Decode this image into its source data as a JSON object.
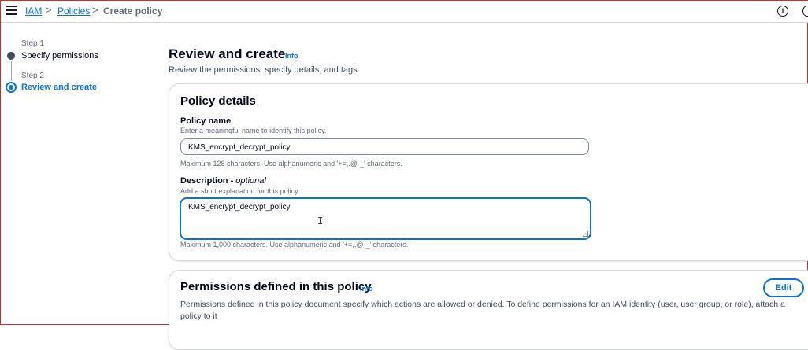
{
  "breadcrumb": {
    "items": [
      {
        "label": "IAM",
        "link": true
      },
      {
        "label": "Policies",
        "link": true
      },
      {
        "label": "Create policy",
        "link": false
      }
    ],
    "separator": ">"
  },
  "header": {
    "info_icon": "ⓘ"
  },
  "steps": [
    {
      "step": "Step 1",
      "title": "Specify permissions",
      "state": "done"
    },
    {
      "step": "Step 2",
      "title": "Review and create",
      "state": "active"
    }
  ],
  "page": {
    "title": "Review and create",
    "info": "Info",
    "description": "Review the permissions, specify details, and tags."
  },
  "policy_details": {
    "title": "Policy details",
    "name_label": "Policy name",
    "name_desc": "Enter a meaningful name to identify this policy.",
    "name_value": "KMS_encrypt_decrypt_policy",
    "name_constraint": "Maximum 128 characters. Use alphanumeric and '+=,.@-_' characters.",
    "description_label": "Description - ",
    "description_optional": "optional",
    "description_desc": "Add a short explanation for this policy.",
    "description_value": "KMS_encrypt_decrypt_policy",
    "description_constraint": "Maximum 1,000 characters. Use alphanumeric and '+=,.@-_' characters."
  },
  "permissions": {
    "title": "Permissions defined in this policy",
    "info": "Info",
    "edit_label": "Edit",
    "description": "Permissions defined in this policy document specify which actions are allowed or denied. To define permissions for an IAM identity (user, user group, or role), attach a policy to it"
  },
  "colors": {
    "accent": "#0972d3",
    "text": "#000716",
    "muted": "#5f6b7a"
  }
}
